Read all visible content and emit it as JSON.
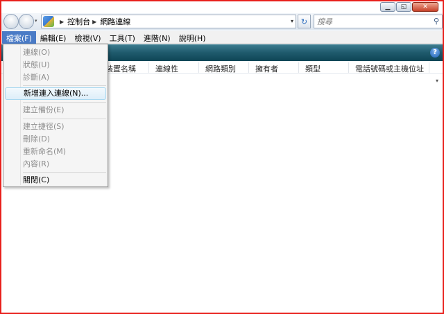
{
  "window": {
    "caption": {
      "minimize": "▁",
      "maximize": "◱",
      "close": "✕"
    }
  },
  "address_bar": {
    "dropdown_glyph": "▾",
    "crumb_sep": "▶",
    "crumbs": [
      "控制台",
      "網路連線"
    ],
    "refresh_glyph": "↻",
    "search_placeholder": "搜尋",
    "search_glyph": "⚲"
  },
  "menubar": {
    "items": [
      "檔案(F)",
      "編輯(E)",
      "檢視(V)",
      "工具(T)",
      "進階(N)",
      "說明(H)"
    ],
    "active_index": 0
  },
  "cmdbar": {
    "help_glyph": "?"
  },
  "columns": {
    "headers": [
      "裝置名稱",
      "連線性",
      "網路類別",
      "擁有者",
      "類型",
      "電話號碼或主機位址"
    ],
    "chevron": "▾"
  },
  "file_menu": {
    "items": [
      {
        "label": "連線(O)",
        "enabled": false
      },
      {
        "label": "狀態(U)",
        "enabled": false
      },
      {
        "label": "診斷(A)",
        "enabled": false
      },
      {
        "label": "新增連入連線(N)...",
        "enabled": true,
        "highlighted": true
      },
      {
        "label": "建立備份(E)",
        "enabled": false
      },
      {
        "label": "建立捷徑(S)",
        "enabled": false
      },
      {
        "label": "刪除(D)",
        "enabled": false
      },
      {
        "label": "重新命名(M)",
        "enabled": false
      },
      {
        "label": "內容(R)",
        "enabled": false
      },
      {
        "label": "關閉(C)",
        "enabled": true
      }
    ]
  },
  "colors": {
    "window_border": "#e8201c",
    "menu_active": "#4a7bc6",
    "command_bar": "#1f5a6c"
  }
}
